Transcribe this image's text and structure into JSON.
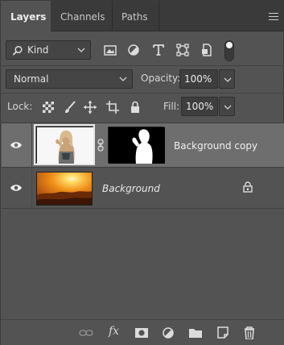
{
  "tabs": [
    {
      "label": "Layers",
      "active": true
    },
    {
      "label": "Channels",
      "active": false
    },
    {
      "label": "Paths",
      "active": false
    }
  ],
  "filter": {
    "kind_label": "Kind",
    "icons": [
      "image-filter-icon",
      "adjustment-filter-icon",
      "type-filter-icon",
      "shape-filter-icon",
      "smart-object-filter-icon"
    ]
  },
  "blend": {
    "mode": "Normal",
    "opacity_label": "Opacity:",
    "opacity_value": "100%"
  },
  "lock": {
    "label": "Lock:",
    "icons": [
      "lock-transparent-pixels-icon",
      "lock-image-pixels-icon",
      "lock-position-icon",
      "lock-artboard-icon",
      "lock-all-icon"
    ],
    "fill_label": "Fill:",
    "fill_value": "100%"
  },
  "layers": [
    {
      "name": "Background copy",
      "visible": true,
      "selected": true,
      "has_mask": true,
      "locked": false
    },
    {
      "name": "Background",
      "visible": true,
      "selected": false,
      "has_mask": false,
      "locked": true
    }
  ],
  "bottom_icons": [
    "link-layers-icon",
    "fx-icon",
    "add-mask-icon",
    "adjustment-layer-icon",
    "new-group-icon",
    "new-layer-icon",
    "delete-layer-icon"
  ],
  "fx_label": "fx",
  "colors": {
    "panel_bg": "#535353",
    "tab_bar_bg": "#3a3a3a",
    "selected_row_bg": "#6e6e6e",
    "text": "#d6d6d6"
  }
}
